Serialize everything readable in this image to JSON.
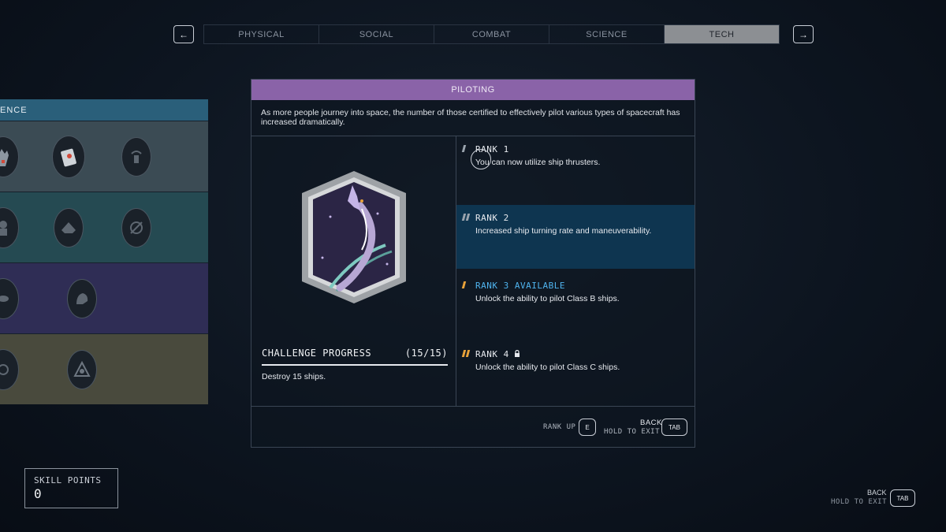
{
  "nav": {
    "prev_icon": "arrow-left",
    "prev_label": "←",
    "next_icon": "arrow-right",
    "next_label": "→",
    "tabs": [
      {
        "label": "PHYSICAL",
        "active": false
      },
      {
        "label": "SOCIAL",
        "active": false
      },
      {
        "label": "COMBAT",
        "active": false
      },
      {
        "label": "SCIENCE",
        "active": false
      },
      {
        "label": "TECH",
        "active": true
      }
    ]
  },
  "left_panel": {
    "header": "ENCE"
  },
  "dialog": {
    "title": "PILOTING",
    "description": "As more people journey into space, the number of those certified to effectively pilot various types of spacecraft has increased dramatically.",
    "challenge": {
      "title": "CHALLENGE PROGRESS",
      "progress": "(15/15)",
      "current": 15,
      "total": 15,
      "description": "Destroy 15 ships."
    },
    "ranks": [
      {
        "title": "RANK 1",
        "text": "You can now utilize ship thrusters.",
        "bars": 1,
        "bar_color": "#9aa3ad",
        "state": "unlocked"
      },
      {
        "title": "RANK 2",
        "text": "Increased ship turning rate and maneuverability.",
        "bars": 2,
        "bar_color": "#9aa3ad",
        "state": "selected"
      },
      {
        "title": "RANK 3 AVAILABLE",
        "text": "Unlock the ability to pilot Class B ships.",
        "bars": 3,
        "bar_color": "#e8a23a",
        "state": "available"
      },
      {
        "title": "RANK 4",
        "text": "Unlock the ability to pilot Class C ships.",
        "bars": 4,
        "bar_color": "#e8a23a",
        "state": "locked"
      }
    ],
    "footer": {
      "rank_up_label": "RANK UP",
      "rank_up_key": "E",
      "back_label": "BACK",
      "hold_label": "HOLD TO EXIT",
      "back_key": "TAB"
    }
  },
  "skill_points": {
    "label": "SKILL POINTS",
    "value": "0"
  },
  "corner": {
    "back_label": "BACK",
    "hold_label": "HOLD TO EXIT",
    "key": "TAB"
  },
  "colors": {
    "accent_purple": "#8a63a8",
    "accent_blue": "#4fb3ee",
    "accent_orange": "#e8a23a",
    "selected_bg": "#0e3550"
  }
}
